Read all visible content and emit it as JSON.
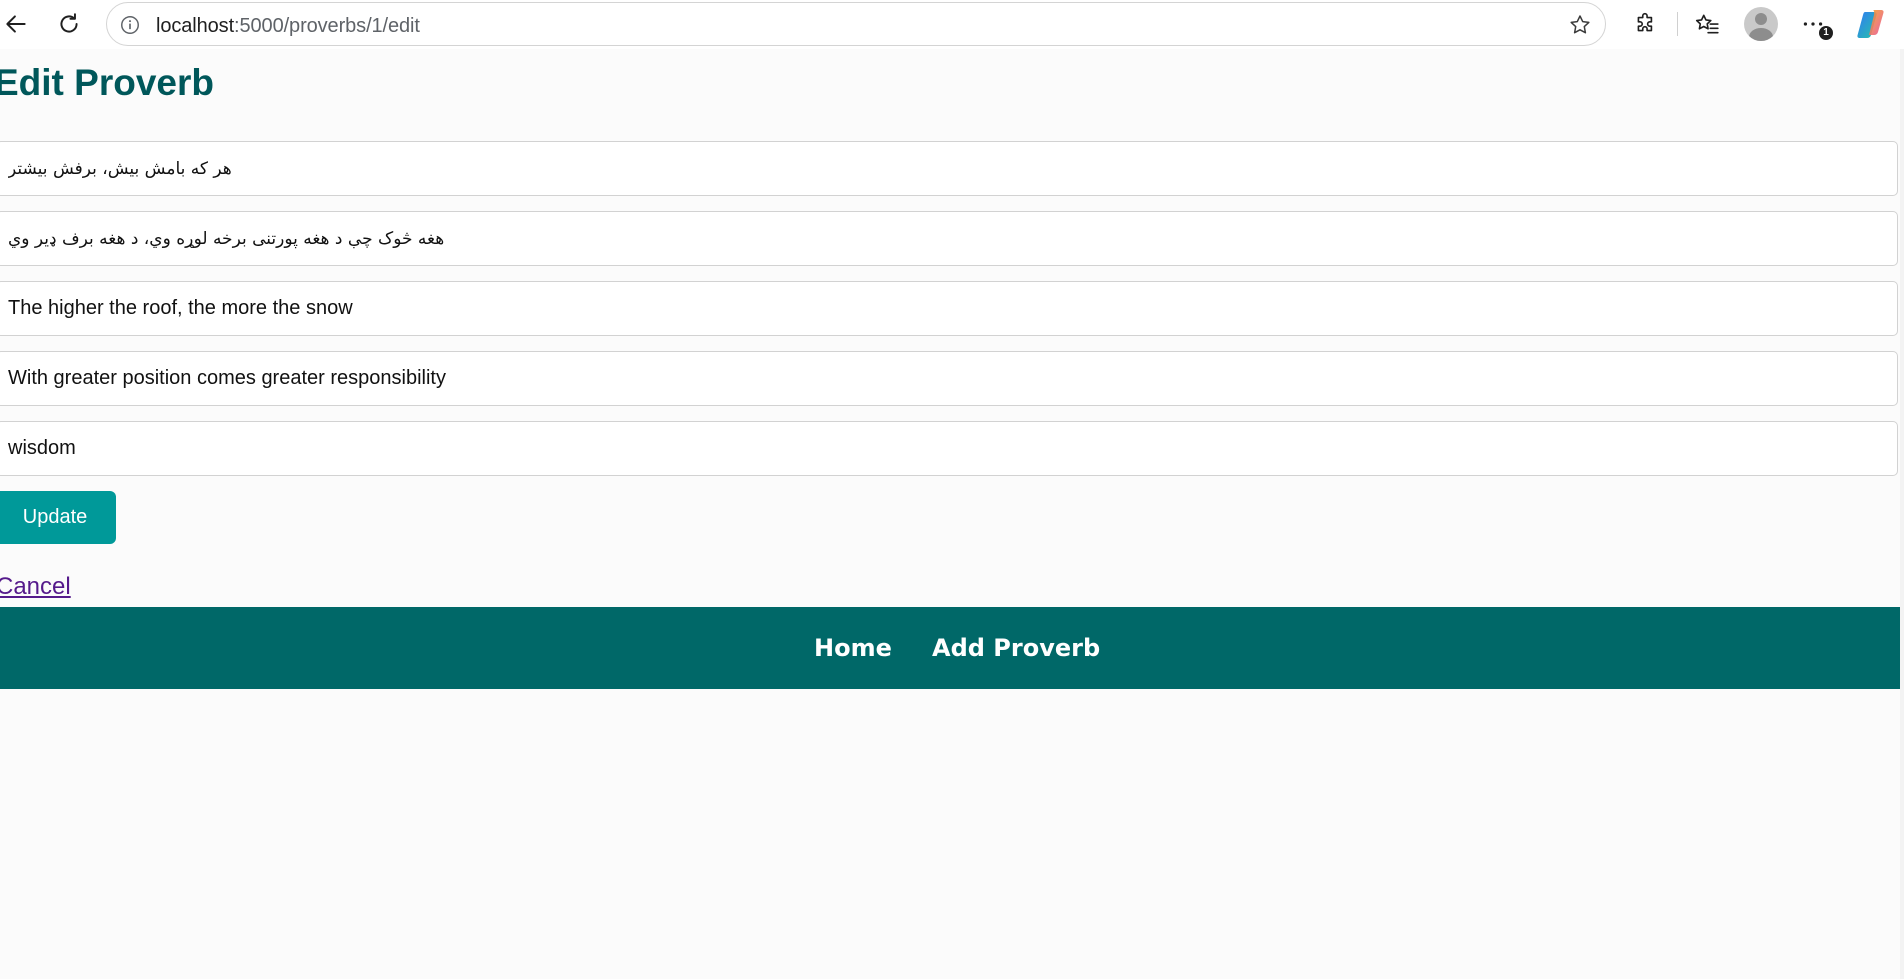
{
  "browser": {
    "url_host": "localhost",
    "url_rest": ":5000/proverbs/1/edit",
    "profile_badge": "1"
  },
  "page": {
    "title": "Edit Proverb"
  },
  "form": {
    "persian_text": "هر که بامش بیش، برفش بیشتر",
    "pashto_text": "هغه څوک چې د هغه پورتنی برخه لوړه وي، د هغه برف ډیر وي",
    "translation": "The higher the roof, the more the snow",
    "meaning": "With greater position comes greater responsibility",
    "category": "wisdom",
    "update_label": "Update",
    "cancel_label": "Cancel"
  },
  "footer": {
    "nav": [
      {
        "label": "Home"
      },
      {
        "label": "Add Proverb"
      }
    ]
  },
  "colors": {
    "title": "#00575a",
    "button": "#009999",
    "footer": "#006868",
    "link_visited": "#551a8b"
  }
}
